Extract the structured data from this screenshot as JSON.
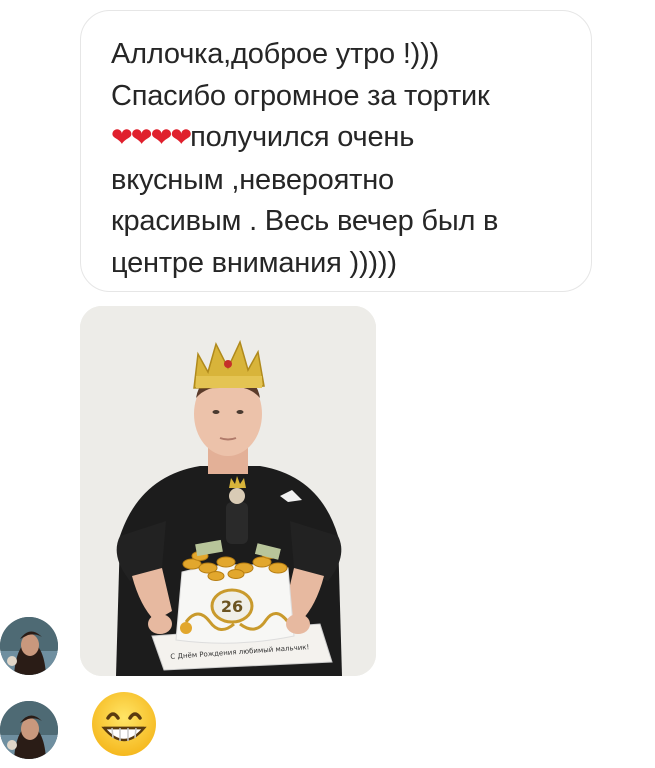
{
  "thread": {
    "message": {
      "lines": [
        "Аллочка,доброе утро !)))",
        "Спасибо огромное за тортик"
      ],
      "hearts": "❤❤❤❤",
      "after_hearts": "получился очень",
      "rest": "вкусным ,невероятно\nкрасивым . Весь вечер был в\nцентре внимания )))))"
    },
    "photo": {
      "description_icon": "cake-photo",
      "cake_number": "26",
      "cake_inscription": "С Днём Рождения любимый мальчик!"
    },
    "reply_emoji": "grinning-face-with-smiling-eyes"
  },
  "colors": {
    "bubble_border": "#e6e6e6",
    "text": "#262626",
    "heart": "#e0202d",
    "crown": "#d8b43a",
    "shirt": "#1c1c1c"
  }
}
